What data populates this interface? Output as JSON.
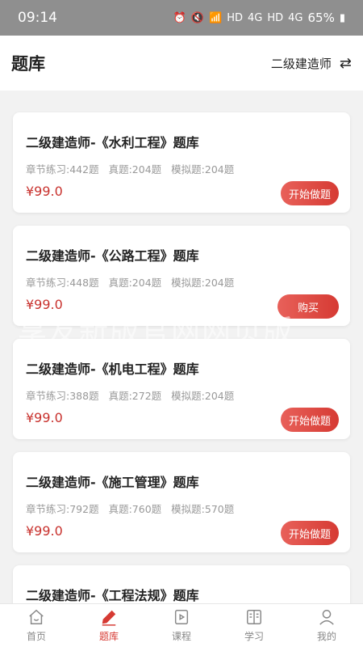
{
  "status": {
    "time": "09:14",
    "net1": "HD",
    "net2": "4G",
    "net3": "HD",
    "net4": "4G",
    "battery": "65%"
  },
  "header": {
    "title": "题库",
    "selected_exam": "二级建造师"
  },
  "items": [
    {
      "name": "二级建造师-《水利工程》题库",
      "chapter": "章节练习:442题",
      "real": "真题:204题",
      "mock": "模拟题:204题",
      "price": "¥99.0",
      "action": "开始做题"
    },
    {
      "name": "二级建造师-《公路工程》题库",
      "chapter": "章节练习:448题",
      "real": "真题:204题",
      "mock": "模拟题:204题",
      "price": "¥99.0",
      "action": "购买"
    },
    {
      "name": "二级建造师-《机电工程》题库",
      "chapter": "章节练习:388题",
      "real": "真题:272题",
      "mock": "模拟题:204题",
      "price": "¥99.0",
      "action": "开始做题"
    },
    {
      "name": "二级建造师-《施工管理》题库",
      "chapter": "章节练习:792题",
      "real": "真题:760题",
      "mock": "模拟题:570题",
      "price": "¥99.0",
      "action": "开始做题"
    },
    {
      "name": "二级建造师-《工程法规》题库",
      "chapter": "",
      "real": "",
      "mock": "",
      "price": "",
      "action": ""
    }
  ],
  "watermark": "享友新版官网网页版",
  "tabs": [
    {
      "label": "首页",
      "icon": "home-icon"
    },
    {
      "label": "题库",
      "icon": "pen-icon"
    },
    {
      "label": "课程",
      "icon": "video-icon"
    },
    {
      "label": "学习",
      "icon": "book-icon"
    },
    {
      "label": "我的",
      "icon": "user-icon"
    }
  ],
  "colors": {
    "accent": "#d63a33",
    "price": "#c8312d"
  }
}
